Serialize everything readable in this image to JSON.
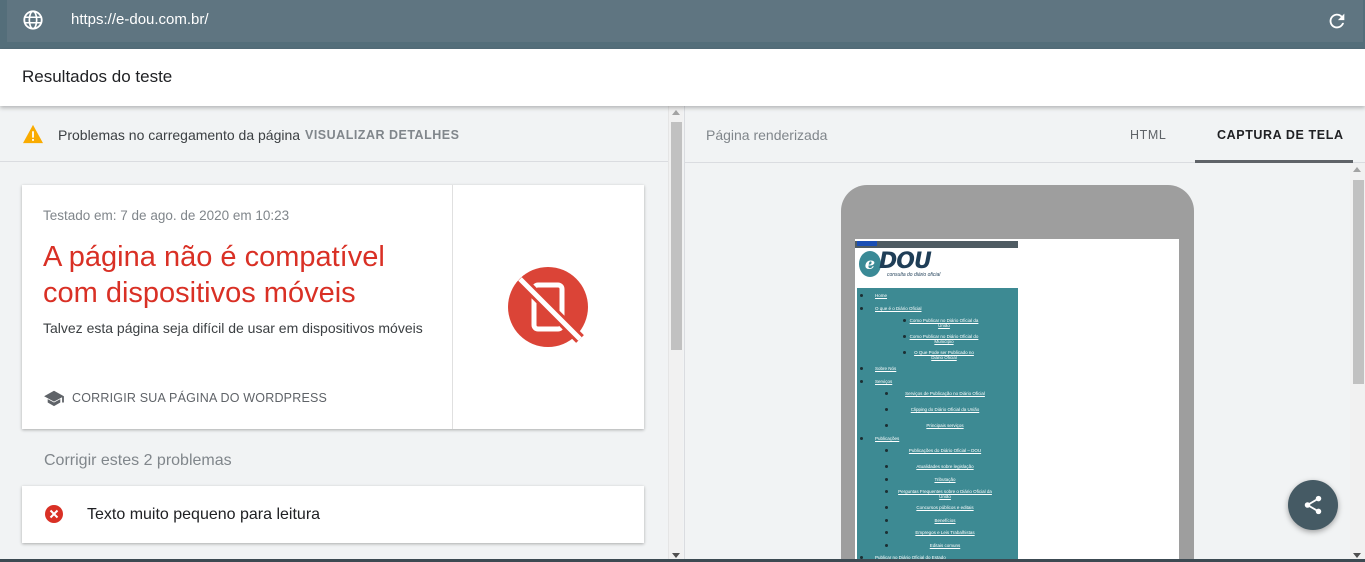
{
  "browser": {
    "url": "https://e-dou.com.br/",
    "globe_icon": "globe-icon",
    "reload_icon": "reload-icon"
  },
  "header": {
    "title": "Resultados do teste"
  },
  "warning": {
    "text": "Problemas no carregamento da página",
    "link": "VISUALIZAR DETALHES",
    "icon": "warning-icon",
    "color": "#f9ab00"
  },
  "result_card": {
    "tested": "Testado em: 7 de ago. de 2020 em 10:23",
    "verdict": "A página não é compatível com dispositivos móveis",
    "verdict_color": "#d93025",
    "subtitle": "Talvez esta página seja difícil de usar em dispositivos móveis",
    "fix_link": "CORRIGIR SUA PÁGINA DO WORDPRESS",
    "fix_icon": "graduation-cap-icon",
    "status_icon": "not-mobile-friendly-icon"
  },
  "problems": {
    "title": "Corrigir estes 2 problemas",
    "items": [
      {
        "label": "Texto muito pequeno para leitura",
        "icon": "error-icon"
      }
    ]
  },
  "right_panel": {
    "label": "Página renderizada",
    "tabs": [
      {
        "label": "HTML",
        "selected": false
      },
      {
        "label": "CAPTURA DE TELA",
        "selected": true
      }
    ]
  },
  "rendered_site": {
    "logo_letter": "e",
    "logo_text": "DOU",
    "tagline": "consulta do diário oficial",
    "menu": [
      {
        "label": "Home",
        "level": 0
      },
      {
        "label": "O que é o Diário Oficial",
        "level": 0
      },
      {
        "label": "Como Publicar no Diário Oficial da União",
        "level": 2
      },
      {
        "label": "Como Publicar no Diário Oficial do Município",
        "level": 2
      },
      {
        "label": "O Que Pode ser Publicado no Diário Oficial",
        "level": 2
      },
      {
        "label": "Sobre Nós",
        "level": 0
      },
      {
        "label": "Serviços",
        "level": 0
      },
      {
        "label": "Serviços de Publicação no Diário Oficial",
        "level": 1
      },
      {
        "label": "Clipping do Diário Oficial da União",
        "level": 1
      },
      {
        "label": "Principais serviços",
        "level": 1
      },
      {
        "label": "Publicações",
        "level": 0
      },
      {
        "label": "Publicações do Diário Oficial – DOU",
        "level": 1
      },
      {
        "label": "Atualidades sobre legislação",
        "level": 1
      },
      {
        "label": "Tributação",
        "level": 1
      },
      {
        "label": "Perguntas Frequentes sobre o Diário Oficial da União",
        "level": 1
      },
      {
        "label": "Concursos públicos e editais",
        "level": 1
      },
      {
        "label": "Benefícios",
        "level": 1
      },
      {
        "label": "Empregos e Leis Trabalhistas",
        "level": 1
      },
      {
        "label": "Editais comuns",
        "level": 1
      },
      {
        "label": "Publicar no Diário Oficial do Estado",
        "level": 0
      }
    ]
  },
  "share_button": {
    "icon": "share-icon"
  }
}
